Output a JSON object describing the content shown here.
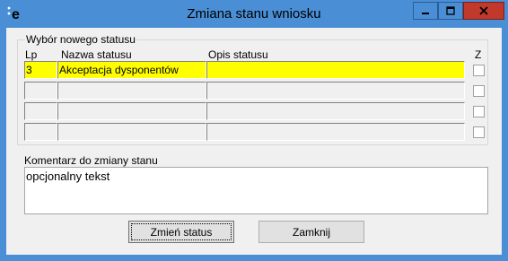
{
  "window": {
    "title": "Zmiana stanu wniosku",
    "app_icon": "e-logo-icon",
    "controls": [
      "minimize-icon",
      "maximize-icon",
      "close-icon"
    ]
  },
  "status_group": {
    "legend": "Wybór nowego statusu",
    "columns": {
      "lp": "Lp",
      "name": "Nazwa statusu",
      "desc": "Opis statusu",
      "z": "Z"
    },
    "rows": [
      {
        "lp": "3",
        "name": "Akceptacja dysponentów",
        "desc": "",
        "selected": true,
        "checked": false
      },
      {
        "lp": "",
        "name": "",
        "desc": "",
        "selected": false,
        "checked": false
      },
      {
        "lp": "",
        "name": "",
        "desc": "",
        "selected": false,
        "checked": false
      },
      {
        "lp": "",
        "name": "",
        "desc": "",
        "selected": false,
        "checked": false
      }
    ]
  },
  "comment": {
    "label": "Komentarz do zmiany stanu",
    "value": "opcjonalny tekst"
  },
  "buttons": {
    "change": "Zmień status",
    "close": "Zamknij"
  },
  "colors": {
    "titlebar": "#4a8fd6",
    "selected_row": "#ffff00",
    "client_bg": "#f0f0f0"
  }
}
